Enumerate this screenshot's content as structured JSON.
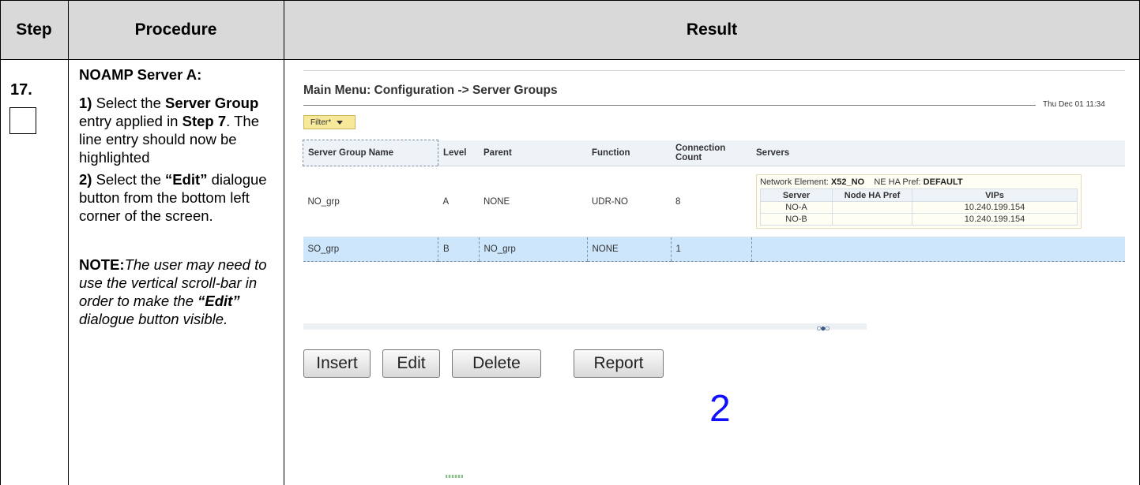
{
  "table": {
    "headers": {
      "step": "Step",
      "procedure": "Procedure",
      "result": "Result"
    },
    "step_number": "17."
  },
  "procedure": {
    "heading": "NOAMP Server A:",
    "s1_num": "1)",
    "s1_a": " Select the ",
    "s1_b": "Server Group",
    "s1_c": " entry applied in ",
    "s1_d": "Step 7",
    "s1_e": ". The line entry should now be highlighted",
    "s2_num": "2)",
    "s2_a": " Select the ",
    "s2_b": "“Edit”",
    "s2_c": " dialogue button from the bottom left corner of the screen.",
    "note_label": "NOTE:",
    "note_a": "The user may need to use the vertical scroll-bar in order to make the ",
    "note_b": "“Edit”",
    "note_c": " dialogue button visible."
  },
  "screen": {
    "title": "Main Menu: Configuration -> Server Groups",
    "datetime": "Thu Dec 01 11:34",
    "filter_label": "Filter*",
    "columns": [
      "Server Group Name",
      "Level",
      "Parent",
      "Function",
      "Connection Count",
      "Servers"
    ],
    "rows": [
      {
        "name": "NO_grp",
        "level": "A",
        "parent": "NONE",
        "function": "UDR-NO",
        "count": "8"
      },
      {
        "name": "SO_grp",
        "level": "B",
        "parent": "NO_grp",
        "function": "NONE",
        "count": "1"
      }
    ],
    "network_element": {
      "label": "Network Element:",
      "value": "X52_NO",
      "pref_label": "NE HA Pref:",
      "pref_value": "DEFAULT",
      "headers": [
        "Server",
        "Node HA Pref",
        "VIPs"
      ],
      "servers": [
        {
          "server": "NO-A",
          "pref": "",
          "vips": "10.240.199.154"
        },
        {
          "server": "NO-B",
          "pref": "",
          "vips": "10.240.199.154"
        }
      ]
    },
    "buttons": {
      "insert": "Insert",
      "edit": "Edit",
      "delete": "Delete",
      "report": "Report"
    },
    "callout": "2",
    "icons": {
      "filter_dropdown": "caret-down-icon",
      "scroll_handle": "scroll-handle-icon"
    }
  }
}
